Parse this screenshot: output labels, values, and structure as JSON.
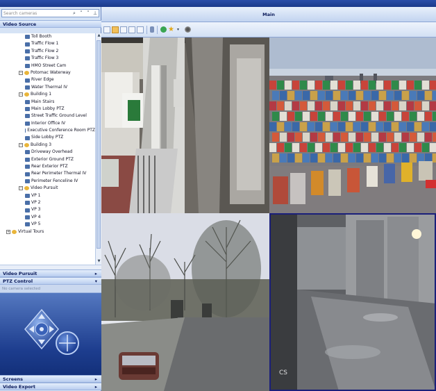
{
  "titlebar": {
    "title": "Main"
  },
  "search": {
    "placeholder": "Search cameras"
  },
  "sections": {
    "video_source": "Video Source",
    "video_pursuit": "Video Pursuit",
    "ptz_control": "PTZ Control",
    "screens": "Screens",
    "video_export": "Video Export"
  },
  "ptz": {
    "status": "No camera selected"
  },
  "main": {
    "title": "Main"
  },
  "tree": [
    {
      "label": "Toll Booth",
      "type": "camera",
      "indent": 4
    },
    {
      "label": "Traffic Flow 1",
      "type": "camera",
      "indent": 4
    },
    {
      "label": "Traffic Flow 2",
      "type": "camera",
      "indent": 4
    },
    {
      "label": "Traffic Flow 3",
      "type": "camera",
      "indent": 4
    },
    {
      "label": "HMO Street Cam",
      "type": "camera",
      "indent": 4
    },
    {
      "label": "Potomac Waterway",
      "type": "group",
      "indent": 3
    },
    {
      "label": "River Edge",
      "type": "camera",
      "indent": 4
    },
    {
      "label": "Water Thermal IV",
      "type": "camera",
      "indent": 4
    },
    {
      "label": "Building 1",
      "type": "group",
      "indent": 3
    },
    {
      "label": "Main Stairs",
      "type": "camera",
      "indent": 4
    },
    {
      "label": "Main Lobby PTZ",
      "type": "camera",
      "indent": 4
    },
    {
      "label": "Street Traffic Ground Level",
      "type": "camera",
      "indent": 4
    },
    {
      "label": "Interior Office IV",
      "type": "camera",
      "indent": 4
    },
    {
      "label": "Executive Conference Room PTZ",
      "type": "camera",
      "indent": 4
    },
    {
      "label": "Side Lobby PTZ",
      "type": "camera",
      "indent": 4
    },
    {
      "label": "Building 3",
      "type": "group",
      "indent": 3
    },
    {
      "label": "Driveway Overhead",
      "type": "camera",
      "indent": 4
    },
    {
      "label": "Exterior Ground PTZ",
      "type": "camera",
      "indent": 4
    },
    {
      "label": "Rear Exterior PTZ",
      "type": "camera",
      "indent": 4
    },
    {
      "label": "Rear Perimeter Thermal IV",
      "type": "camera",
      "indent": 4
    },
    {
      "label": "Perimeter Fenceline IV",
      "type": "camera",
      "indent": 4
    },
    {
      "label": "Video Pursuit",
      "type": "group",
      "indent": 3
    },
    {
      "label": "VP 1",
      "type": "camera",
      "indent": 4
    },
    {
      "label": "VP 2",
      "type": "camera",
      "indent": 4
    },
    {
      "label": "VP 3",
      "type": "camera",
      "indent": 4
    },
    {
      "label": "VP 4",
      "type": "camera",
      "indent": 4
    },
    {
      "label": "VP 5",
      "type": "camera",
      "indent": 4
    },
    {
      "label": "Virtual Tours",
      "type": "group",
      "indent": 1
    }
  ],
  "video_tiles": [
    {
      "name": "video-tile-walkway"
    },
    {
      "name": "video-tile-container-yard"
    },
    {
      "name": "video-tile-driveway-trees"
    },
    {
      "name": "video-tile-warehouse-rain",
      "overlay": "CS"
    }
  ]
}
